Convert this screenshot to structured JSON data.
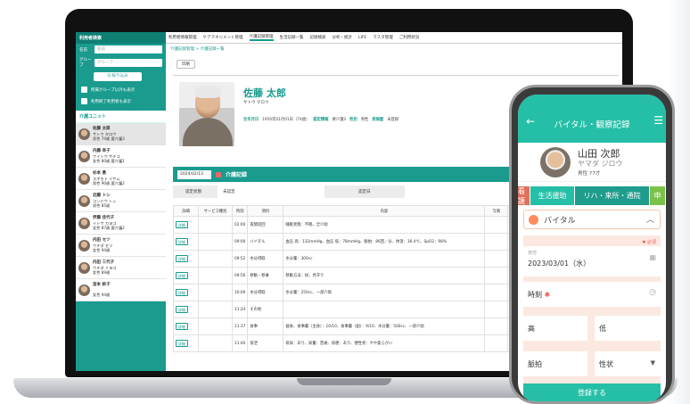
{
  "sidebar": {
    "header": "利用者検索",
    "name_label": "名前",
    "name_placeholder": "名前",
    "group_label": "グループ",
    "group_placeholder": "グループ",
    "filter_button": "Q 絞り込み",
    "check1": "所属グループ以外も表示",
    "check2": "利用終了利用者も表示",
    "unit_title": "介護ユニット",
    "persons": [
      {
        "name": "佐藤 太郎",
        "kana": "サトウ タロウ",
        "meta": "男性  74歳  要介護3"
      },
      {
        "name": "内藤 幸子",
        "kana": "ナイトウ サチコ",
        "meta": "女性  80歳  要介護1"
      },
      {
        "name": "杉本 勇",
        "kana": "スギモト イサム",
        "meta": "男性  90歳  要介護2"
      },
      {
        "name": "近藤 トシ",
        "kana": "コンドウ トシ",
        "meta": "男性  85歳"
      },
      {
        "name": "伊藤 佳代子",
        "kana": "イトウ カヨコ",
        "meta": "女性  87歳  要介護2"
      },
      {
        "name": "内田 セツ",
        "kana": "ウチダ セツ",
        "meta": "女性  94歳"
      },
      {
        "name": "内田 三代子",
        "kana": "ウチダ ミヨコ",
        "meta": "女性  89歳"
      },
      {
        "name": "宮本 鈴子",
        "kana": "",
        "meta": "女性  94歳"
      }
    ]
  },
  "topnav": [
    "利用者情報管理",
    "ケアマネジメント管理",
    "介護記録管理",
    "生活記録一覧",
    "記録検索",
    "分析・統計",
    "LIFE",
    "マスタ管理",
    "ご利用状況"
  ],
  "breadcrumb": "介護記録管理 > 介護記録一覧",
  "print_label": "印刷",
  "profile": {
    "name": "佐藤 太郎",
    "kana": "サトウ タロウ",
    "birth_label": "生年月日",
    "birth_value": "1950年01月01日（74歳）",
    "cert_label": "認定情報",
    "cert_value": "要介護3",
    "sex_label": "性別",
    "sex_value": "男性",
    "disease_label": "疾病歴",
    "disease_value": "未登録"
  },
  "record": {
    "date": "2024/02/13",
    "title": "介護記録",
    "status_label": "認定状態",
    "status_value": "未認定",
    "period_label": "認定日"
  },
  "table": {
    "headers": [
      "詳細",
      "サービス種別",
      "時刻",
      "項目",
      "内容",
      "写真"
    ],
    "detail_label": "詳細",
    "rows": [
      {
        "time": "02:00",
        "item": "夜間巡回",
        "content": "睡眠状態：不眠、全介助",
        "extra": ""
      },
      {
        "time": "09:00",
        "item": "バイタル",
        "content": "血圧 高：132mmHg、血圧 低：78mmHg、脈拍：86回／分、体温：36.4℃、SpO2：98%",
        "extra": ""
      },
      {
        "time": "09:52",
        "item": "水分摂取",
        "content": "水分量：300cc",
        "extra": "飲まれ"
      },
      {
        "time": "09:56",
        "item": "移動・移乗",
        "content": "移動方法：杖、見守り",
        "extra": "ふらつ"
      },
      {
        "time": "10:00",
        "item": "水分摂取",
        "content": "水分量：250cc、一部介助",
        "extra": "紅茶を"
      },
      {
        "time": "11:24",
        "item": "その他",
        "content": "",
        "extra": "歯痛の"
      },
      {
        "time": "11:37",
        "item": "食事",
        "content": "昼食、食事量（主食）：10/10、食事量（副）：9/10、水分量：500cc、一部介助",
        "extra": ""
      },
      {
        "time": "11:40",
        "item": "排泄",
        "content": "排尿：あり、尿量：普通、排便：あり、便性状：やや柔らかい",
        "extra": "こて"
      }
    ]
  },
  "phone": {
    "title": "バイタル・観察記録",
    "name": "山田 次郎",
    "kana": "ヤマダ ジロウ",
    "meta": "男性 77才",
    "tabs": [
      "看護",
      "生活援助",
      "リハ・来所・通院",
      "申"
    ],
    "tab_colors": [
      "#e0705a",
      "#24bfa6",
      "#1e9c8c",
      "#7bc24a"
    ],
    "section": "バイタル",
    "required_note": "✱ 必須",
    "date_label": "日付",
    "date_value": "2023/03/01（水）",
    "time_label": "時刻",
    "required_mark": "✱",
    "high_label": "高",
    "low_label": "低",
    "pulse_label": "脈拍",
    "nature_label": "性状",
    "submit": "登録する"
  }
}
